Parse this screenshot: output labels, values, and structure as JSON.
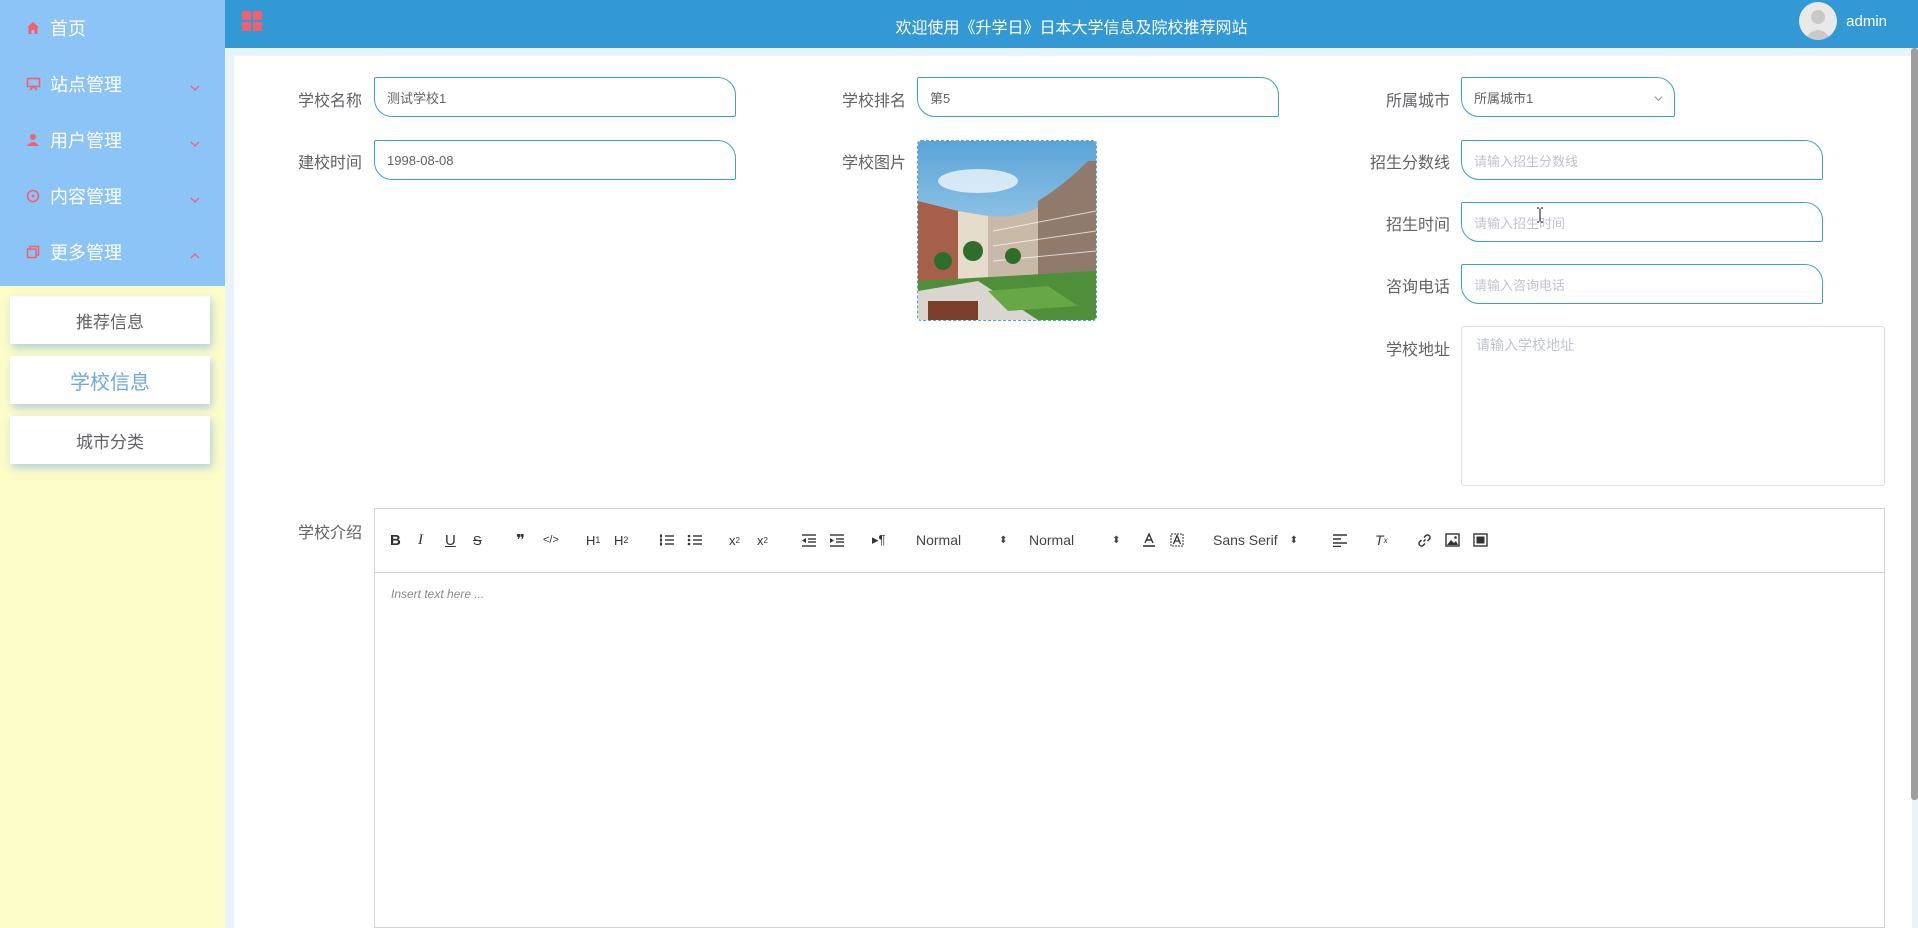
{
  "header": {
    "title": "欢迎使用《升学日》日本大学信息及院校推荐网站",
    "username": "admin"
  },
  "sidebar": {
    "items": [
      {
        "label": "首页",
        "icon": "home-icon"
      },
      {
        "label": "站点管理",
        "icon": "monitor-icon"
      },
      {
        "label": "用户管理",
        "icon": "user-icon"
      },
      {
        "label": "内容管理",
        "icon": "chat-icon"
      },
      {
        "label": "更多管理",
        "icon": "copy-icon"
      }
    ],
    "submenu": [
      {
        "label": "推荐信息"
      },
      {
        "label": "学校信息",
        "active": true
      },
      {
        "label": "城市分类"
      }
    ]
  },
  "form": {
    "school_name": {
      "label": "学校名称",
      "value": "测试学校1"
    },
    "school_rank": {
      "label": "学校排名",
      "value": "第5"
    },
    "city": {
      "label": "所属城市",
      "value": "所属城市1"
    },
    "founded": {
      "label": "建校时间",
      "value": "1998-08-08"
    },
    "photo": {
      "label": "学校图片"
    },
    "score_line": {
      "label": "招生分数线",
      "placeholder": "请输入招生分数线"
    },
    "enroll_time": {
      "label": "招生时间",
      "placeholder": "请输入招生时间"
    },
    "phone": {
      "label": "咨询电话",
      "placeholder": "请输入咨询电话"
    },
    "address": {
      "label": "学校地址",
      "placeholder": "请输入学校地址"
    },
    "intro": {
      "label": "学校介绍",
      "placeholder": "Insert text here ..."
    }
  },
  "editor": {
    "header_select": "Normal",
    "size_select": "Normal",
    "font_select": "Sans Serif",
    "buttons": [
      "B",
      "I",
      "U",
      "S",
      "❞",
      "</>",
      "H1",
      "H2",
      "ol",
      "ul",
      "x2",
      "x2",
      "outdent",
      "indent",
      "¶",
      "A",
      "A",
      "align",
      "Tx",
      "link",
      "image",
      "video"
    ]
  },
  "colors": {
    "header_bg": "#3399d4",
    "sidebar_menu_bg": "#8cc4f8",
    "sidebar_bg": "#fdfdc9",
    "accent_red": "#f2606b",
    "input_border": "#3ba0d8"
  }
}
